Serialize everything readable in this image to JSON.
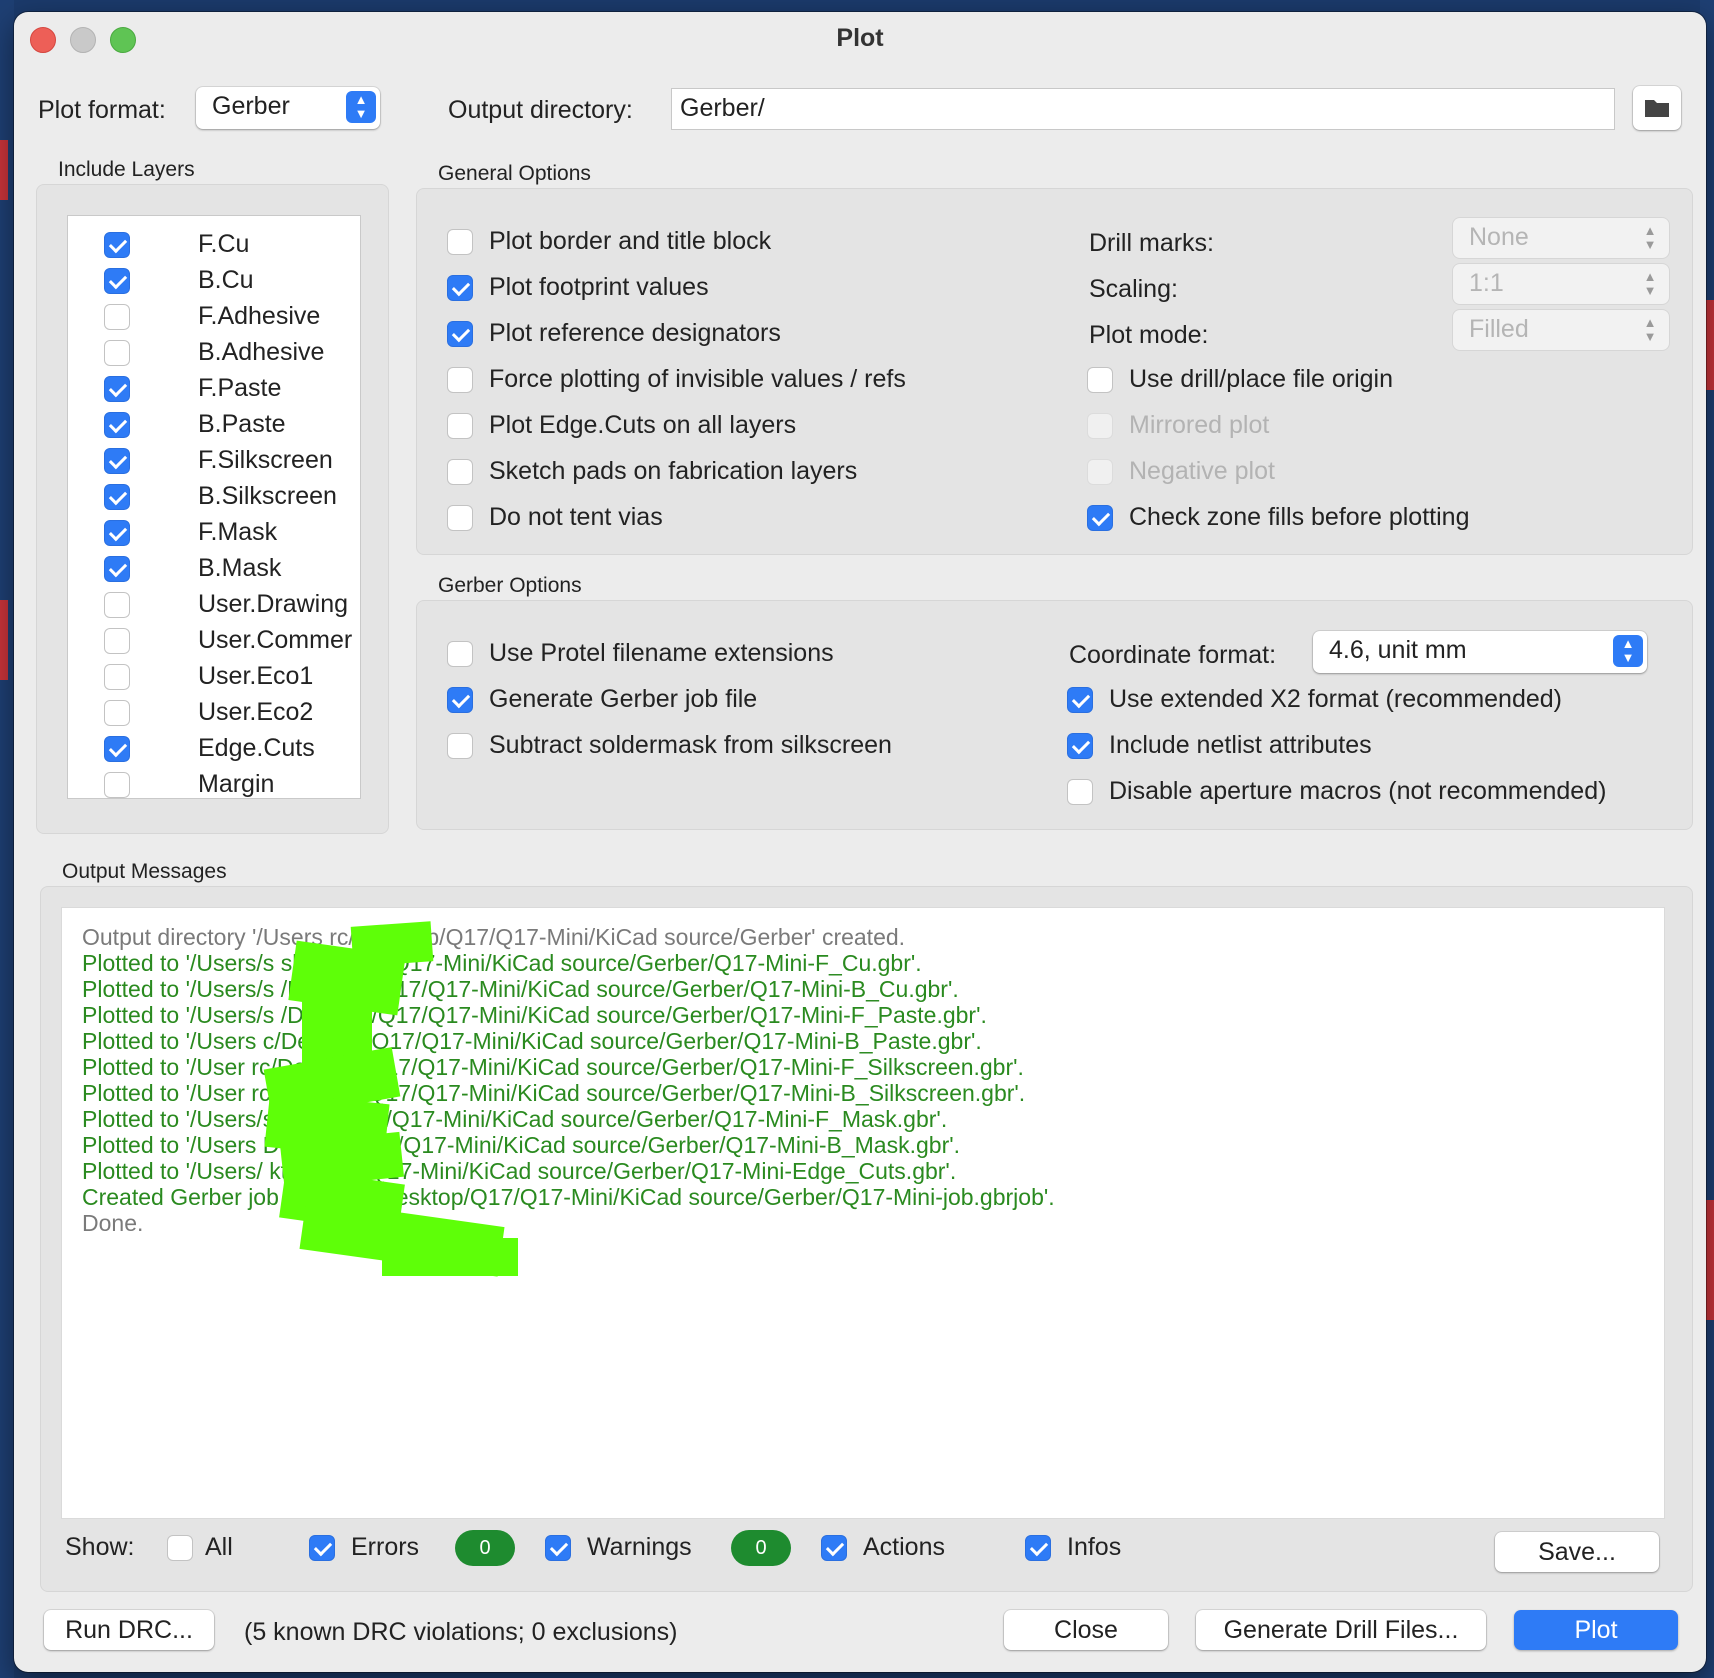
{
  "window": {
    "title": "Plot"
  },
  "top": {
    "plot_format_label": "Plot format:",
    "plot_format_value": "Gerber",
    "output_dir_label": "Output directory:",
    "output_dir_value": "Gerber/"
  },
  "layers": {
    "title": "Include Layers",
    "items": [
      {
        "label": "F.Cu",
        "checked": true
      },
      {
        "label": "B.Cu",
        "checked": true
      },
      {
        "label": "F.Adhesive",
        "checked": false
      },
      {
        "label": "B.Adhesive",
        "checked": false
      },
      {
        "label": "F.Paste",
        "checked": true
      },
      {
        "label": "B.Paste",
        "checked": true
      },
      {
        "label": "F.Silkscreen",
        "checked": true
      },
      {
        "label": "B.Silkscreen",
        "checked": true
      },
      {
        "label": "F.Mask",
        "checked": true
      },
      {
        "label": "B.Mask",
        "checked": true
      },
      {
        "label": "User.Drawing",
        "checked": false
      },
      {
        "label": "User.Commer",
        "checked": false
      },
      {
        "label": "User.Eco1",
        "checked": false
      },
      {
        "label": "User.Eco2",
        "checked": false
      },
      {
        "label": "Edge.Cuts",
        "checked": true
      },
      {
        "label": "Margin",
        "checked": false
      }
    ]
  },
  "general": {
    "title": "General Options",
    "left_options": [
      {
        "label": "Plot border and title block",
        "checked": false
      },
      {
        "label": "Plot footprint values",
        "checked": true
      },
      {
        "label": "Plot reference designators",
        "checked": true
      },
      {
        "label": "Force plotting of invisible values / refs",
        "checked": false
      },
      {
        "label": "Plot Edge.Cuts on all layers",
        "checked": false
      },
      {
        "label": "Sketch pads on fabrication layers",
        "checked": false
      },
      {
        "label": "Do not tent vias",
        "checked": false
      }
    ],
    "drill_marks_label": "Drill marks:",
    "drill_marks_value": "None",
    "scaling_label": "Scaling:",
    "scaling_value": "1:1",
    "plot_mode_label": "Plot mode:",
    "plot_mode_value": "Filled",
    "right_options": [
      {
        "label": "Use drill/place file origin",
        "checked": false,
        "disabled": false
      },
      {
        "label": "Mirrored plot",
        "checked": false,
        "disabled": true
      },
      {
        "label": "Negative plot",
        "checked": false,
        "disabled": true
      },
      {
        "label": "Check zone fills before plotting",
        "checked": true,
        "disabled": false
      }
    ]
  },
  "gerber": {
    "title": "Gerber Options",
    "left_options": [
      {
        "label": "Use Protel filename extensions",
        "checked": false
      },
      {
        "label": "Generate Gerber job file",
        "checked": true
      },
      {
        "label": "Subtract soldermask from silkscreen",
        "checked": false
      }
    ],
    "coord_label": "Coordinate format:",
    "coord_value": "4.6, unit mm",
    "right_options": [
      {
        "label": "Use extended X2 format (recommended)",
        "checked": true
      },
      {
        "label": "Include netlist attributes",
        "checked": true
      },
      {
        "label": "Disable aperture macros (not recommended)",
        "checked": false
      }
    ]
  },
  "messages": {
    "title": "Output Messages",
    "lines": [
      {
        "text": "Output directory '/Users                 rc/Desktop/Q17/Q17-Mini/KiCad source/Gerber' created.",
        "kind": "info"
      },
      {
        "text": "Plotted to '/Users/s                   sktop/Q17/Q17-Mini/KiCad source/Gerber/Q17-Mini-F_Cu.gbr'.",
        "kind": "action"
      },
      {
        "text": "Plotted to '/Users/s                   /Desktop/Q17/Q17-Mini/KiCad source/Gerber/Q17-Mini-B_Cu.gbr'.",
        "kind": "action"
      },
      {
        "text": "Plotted to '/Users/s                   /Desktop/Q17/Q17-Mini/KiCad source/Gerber/Q17-Mini-F_Paste.gbr'.",
        "kind": "action"
      },
      {
        "text": "Plotted to '/Users                  c/Desktop/Q17/Q17-Mini/KiCad source/Gerber/Q17-Mini-B_Paste.gbr'.",
        "kind": "action"
      },
      {
        "text": "Plotted to '/User                   rc/Desktop/Q17/Q17-Mini/KiCad source/Gerber/Q17-Mini-F_Silkscreen.gbr'.",
        "kind": "action"
      },
      {
        "text": "Plotted to '/User                   rc/Desktop/Q17/Q17-Mini/KiCad source/Gerber/Q17-Mini-B_Silkscreen.gbr'.",
        "kind": "action"
      },
      {
        "text": "Plotted to '/Users/s                  sktop/Q17/Q17-Mini/KiCad source/Gerber/Q17-Mini-F_Mask.gbr'.",
        "kind": "action"
      },
      {
        "text": "Plotted to '/Users                   Desktop/Q17/Q17-Mini/KiCad source/Gerber/Q17-Mini-B_Mask.gbr'.",
        "kind": "action"
      },
      {
        "text": "Plotted to '/Users/                   ktop/Q17/Q17-Mini/KiCad source/Gerber/Q17-Mini-Edge_Cuts.gbr'.",
        "kind": "action"
      },
      {
        "text": "Created Gerber job file '/Use                   Desktop/Q17/Q17-Mini/KiCad source/Gerber/Q17-Mini-job.gbrjob'.",
        "kind": "action"
      },
      {
        "text": "Done.",
        "kind": "info"
      }
    ],
    "show_label": "Show:",
    "filters": [
      {
        "label": "All",
        "checked": false
      },
      {
        "label": "Errors",
        "checked": true,
        "count": "0"
      },
      {
        "label": "Warnings",
        "checked": true,
        "count": "0"
      },
      {
        "label": "Actions",
        "checked": true
      },
      {
        "label": "Infos",
        "checked": true
      }
    ],
    "save_label": "Save..."
  },
  "footer": {
    "run_drc_label": "Run DRC...",
    "drc_status": "(5 known DRC violations; 0 exclusions)",
    "close_label": "Close",
    "drill_label": "Generate Drill Files...",
    "plot_label": "Plot"
  },
  "colors": {
    "accent": "#2e7bf6",
    "info_text": "#7a7a7a",
    "action_text": "#2a8a1f",
    "badge": "#1e8b2f",
    "redaction": "#5eff08"
  }
}
